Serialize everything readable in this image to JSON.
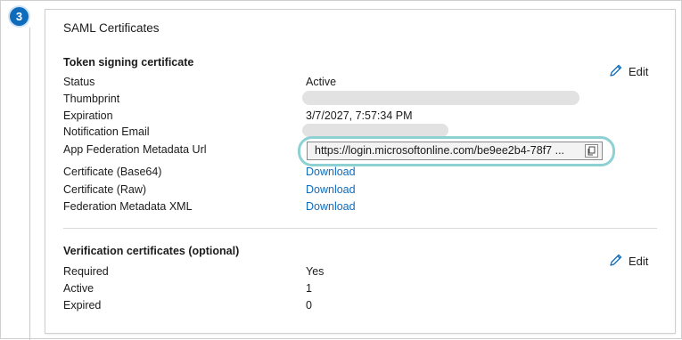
{
  "step": {
    "number": "3"
  },
  "card": {
    "title": "SAML Certificates"
  },
  "token_signing": {
    "title": "Token signing certificate",
    "edit_label": "Edit",
    "rows": {
      "status": {
        "label": "Status",
        "value": "Active"
      },
      "thumbprint": {
        "label": "Thumbprint"
      },
      "expiration": {
        "label": "Expiration",
        "value": "3/7/2027, 7:57:34 PM"
      },
      "notification_email": {
        "label": "Notification Email"
      },
      "metadata_url": {
        "label": "App Federation Metadata Url",
        "value": "https://login.microsoftonline.com/be9ee2b4-78f7 ..."
      },
      "cert_base64": {
        "label": "Certificate (Base64)",
        "value": "Download"
      },
      "cert_raw": {
        "label": "Certificate (Raw)",
        "value": "Download"
      },
      "federation_xml": {
        "label": "Federation Metadata XML",
        "value": "Download"
      }
    }
  },
  "verification": {
    "title": "Verification certificates (optional)",
    "edit_label": "Edit",
    "rows": {
      "required": {
        "label": "Required",
        "value": "Yes"
      },
      "active": {
        "label": "Active",
        "value": "1"
      },
      "expired": {
        "label": "Expired",
        "value": "0"
      }
    }
  },
  "colors": {
    "accent": "#0f6cbd",
    "highlight": "#8ed1d2"
  },
  "icons": {
    "edit": "pencil-icon",
    "copy": "copy-icon"
  }
}
